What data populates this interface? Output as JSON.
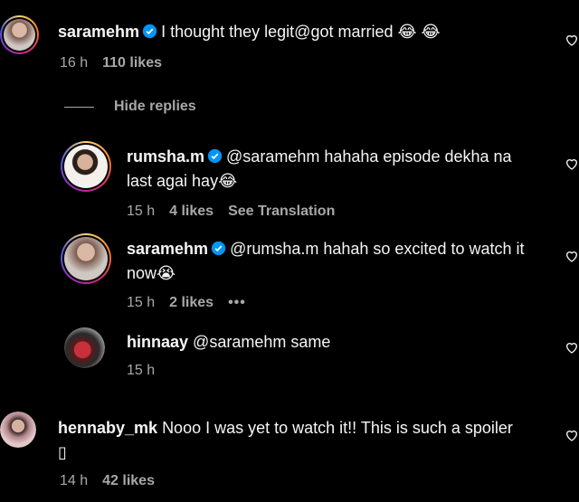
{
  "comments": [
    {
      "user": "saramehm",
      "text": "I thought they legit@got married 😂 😂",
      "time": "16 h",
      "likes": "110 likes"
    },
    {
      "user": "rumsha.m",
      "text_line1": "@saramehm hahaha episode dekha na",
      "text_line2": "last agai hay😂",
      "time": "15 h",
      "likes": "4 likes",
      "translate": "See Translation"
    },
    {
      "user": "saramehm",
      "text_line1": "@rumsha.m hahah so excited to watch it",
      "text_line2": "now😭",
      "time": "15 h",
      "likes": "2 likes",
      "more": "•••"
    },
    {
      "user": "hinnaay",
      "text": "@saramehm same",
      "time": "15 h"
    },
    {
      "user": "hennaby_mk",
      "text_line1": "Nooo I was yet to watch it!! This is such a spoiler",
      "text_line2": "▯",
      "time": "14 h",
      "likes": "42 likes"
    }
  ],
  "hide_replies": "Hide replies",
  "colors": {
    "verified": "#0095f6",
    "secondary": "#a8a8a8"
  }
}
